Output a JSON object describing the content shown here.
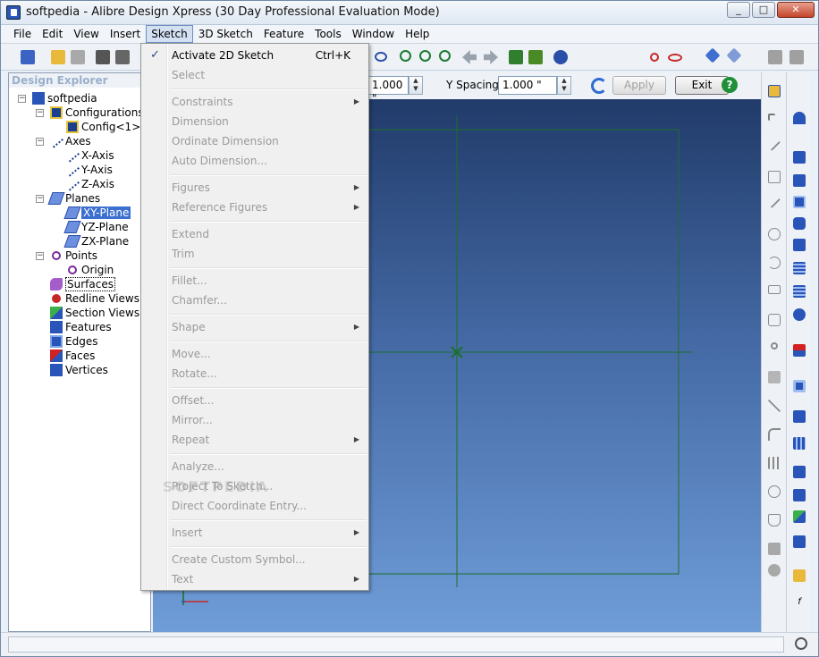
{
  "window": {
    "title": "softpedia - Alibre Design Xpress (30 Day Professional Evaluation Mode)",
    "minimize": "_",
    "maximize": "□",
    "close": "✕"
  },
  "menubar": [
    "File",
    "Edit",
    "View",
    "Insert",
    "Sketch",
    "3D Sketch",
    "Feature",
    "Tools",
    "Window",
    "Help"
  ],
  "propbar": {
    "x_spacing_value": "1.000 \"",
    "y_spacing_label": "Y Spacing",
    "y_spacing_value": "1.000 \"",
    "apply_label": "Apply",
    "exit_label": "Exit"
  },
  "explorer": {
    "header": "Design Explorer",
    "items": [
      {
        "label": "softpedia"
      },
      {
        "label": "Configurations"
      },
      {
        "label": "Config<1>"
      },
      {
        "label": "Axes"
      },
      {
        "label": "X-Axis"
      },
      {
        "label": "Y-Axis"
      },
      {
        "label": "Z-Axis"
      },
      {
        "label": "Planes"
      },
      {
        "label": "XY-Plane"
      },
      {
        "label": "YZ-Plane"
      },
      {
        "label": "ZX-Plane"
      },
      {
        "label": "Points"
      },
      {
        "label": "Origin"
      },
      {
        "label": "Surfaces"
      },
      {
        "label": "Redline Views"
      },
      {
        "label": "Section Views"
      },
      {
        "label": "Features"
      },
      {
        "label": "Edges"
      },
      {
        "label": "Faces"
      },
      {
        "label": "Vertices"
      }
    ]
  },
  "sketch_menu": {
    "items": [
      {
        "label": "Activate 2D Sketch",
        "shortcut": "Ctrl+K",
        "checked": true
      },
      {
        "label": "Select"
      },
      {
        "label": "Constraints",
        "submenu": true
      },
      {
        "label": "Dimension"
      },
      {
        "label": "Ordinate Dimension"
      },
      {
        "label": "Auto Dimension..."
      },
      {
        "label": "Figures",
        "submenu": true
      },
      {
        "label": "Reference Figures",
        "submenu": true
      },
      {
        "label": "Extend"
      },
      {
        "label": "Trim"
      },
      {
        "label": "Fillet..."
      },
      {
        "label": "Chamfer..."
      },
      {
        "label": "Shape",
        "submenu": true
      },
      {
        "label": "Move..."
      },
      {
        "label": "Rotate..."
      },
      {
        "label": "Offset..."
      },
      {
        "label": "Mirror..."
      },
      {
        "label": "Repeat",
        "submenu": true
      },
      {
        "label": "Analyze..."
      },
      {
        "label": "Project To Sketch..."
      },
      {
        "label": "Direct Coordinate Entry..."
      },
      {
        "label": "Insert",
        "submenu": true
      },
      {
        "label": "Create Custom Symbol..."
      },
      {
        "label": "Text",
        "submenu": true
      }
    ],
    "checkmark": "✓",
    "submenu_arrow": "▶"
  },
  "canvas": {
    "watermark": "SOFTPEDIA",
    "sketch_color": "#1d6e2b",
    "background_top": "#213b6a",
    "background_bottom": "#6f9dd8"
  },
  "icons": {
    "tree_expand": "−",
    "spin_up": "▲",
    "spin_down": "▼",
    "help": "?"
  }
}
